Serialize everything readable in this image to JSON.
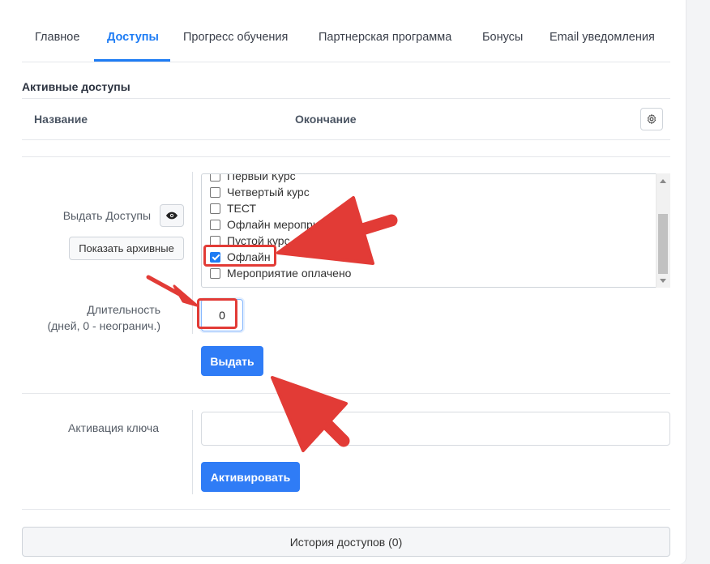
{
  "tabs": [
    {
      "label": "Главное"
    },
    {
      "label": "Доступы"
    },
    {
      "label": "Прогресс обучения"
    },
    {
      "label": "Партнерская программа"
    },
    {
      "label": "Бонусы"
    },
    {
      "label": "Email уведомления"
    }
  ],
  "active_tab": "Доступы",
  "active_access": {
    "title": "Активные доступы",
    "columns": [
      "Название",
      "Окончание"
    ]
  },
  "grant": {
    "label": "Выдать Доступы",
    "show_archive_label": "Показать архивные",
    "courses": [
      {
        "label": "Первый Курс",
        "checked": false
      },
      {
        "label": "Четвертый курс",
        "checked": false
      },
      {
        "label": "ТЕСТ",
        "checked": false
      },
      {
        "label": "Офлайн мероприя",
        "checked": false
      },
      {
        "label": "Пустой курс",
        "checked": false
      },
      {
        "label": "Офлайн",
        "checked": true
      },
      {
        "label": "Мероприятие оплачено",
        "checked": false
      }
    ],
    "duration_label_1": "Длительность",
    "duration_label_2": "(дней, 0 - неогранич.)",
    "duration_value": "0",
    "submit_label": "Выдать"
  },
  "key": {
    "label": "Активация ключа",
    "value": "",
    "submit_label": "Активировать"
  },
  "history_label": "История доступов (0)",
  "colors": {
    "accent": "#1e7cf4",
    "button": "#2f7cf6",
    "annotation": "#e23b36"
  }
}
